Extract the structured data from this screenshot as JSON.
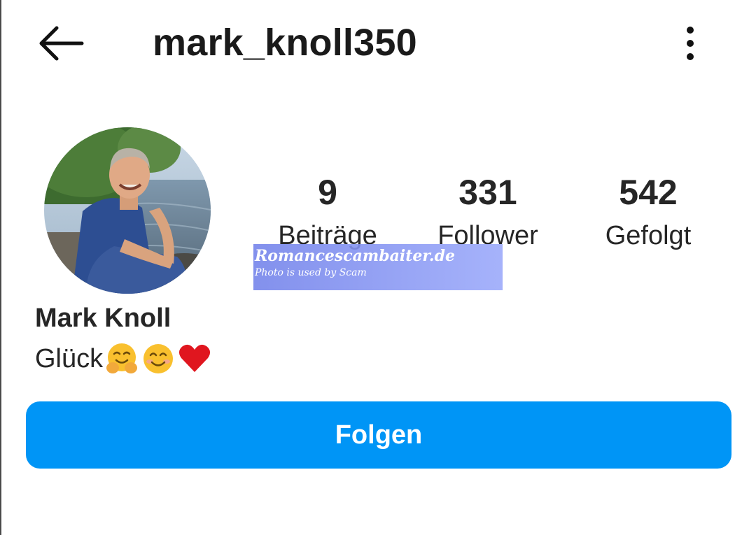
{
  "header": {
    "username": "mark_knoll350",
    "back_icon": "arrow-left-icon",
    "more_icon": "more-vertical-icon"
  },
  "profile": {
    "avatar_icon": "profile-photo",
    "full_name": "Mark Knoll",
    "bio_text": "Glück",
    "bio_emojis": [
      "hugging-face-emoji",
      "smiling-face-emoji",
      "red-heart-emoji"
    ]
  },
  "stats": [
    {
      "value": "9",
      "label": "Beiträge"
    },
    {
      "value": "331",
      "label": "Follower"
    },
    {
      "value": "542",
      "label": "Gefolgt"
    }
  ],
  "watermark": {
    "title": "Romancescambaiter.de",
    "subtitle": "Photo is used by Scam"
  },
  "actions": {
    "follow_label": "Folgen"
  },
  "colors": {
    "follow_button": "#0095f6",
    "text": "#262626",
    "background": "#ffffff"
  }
}
